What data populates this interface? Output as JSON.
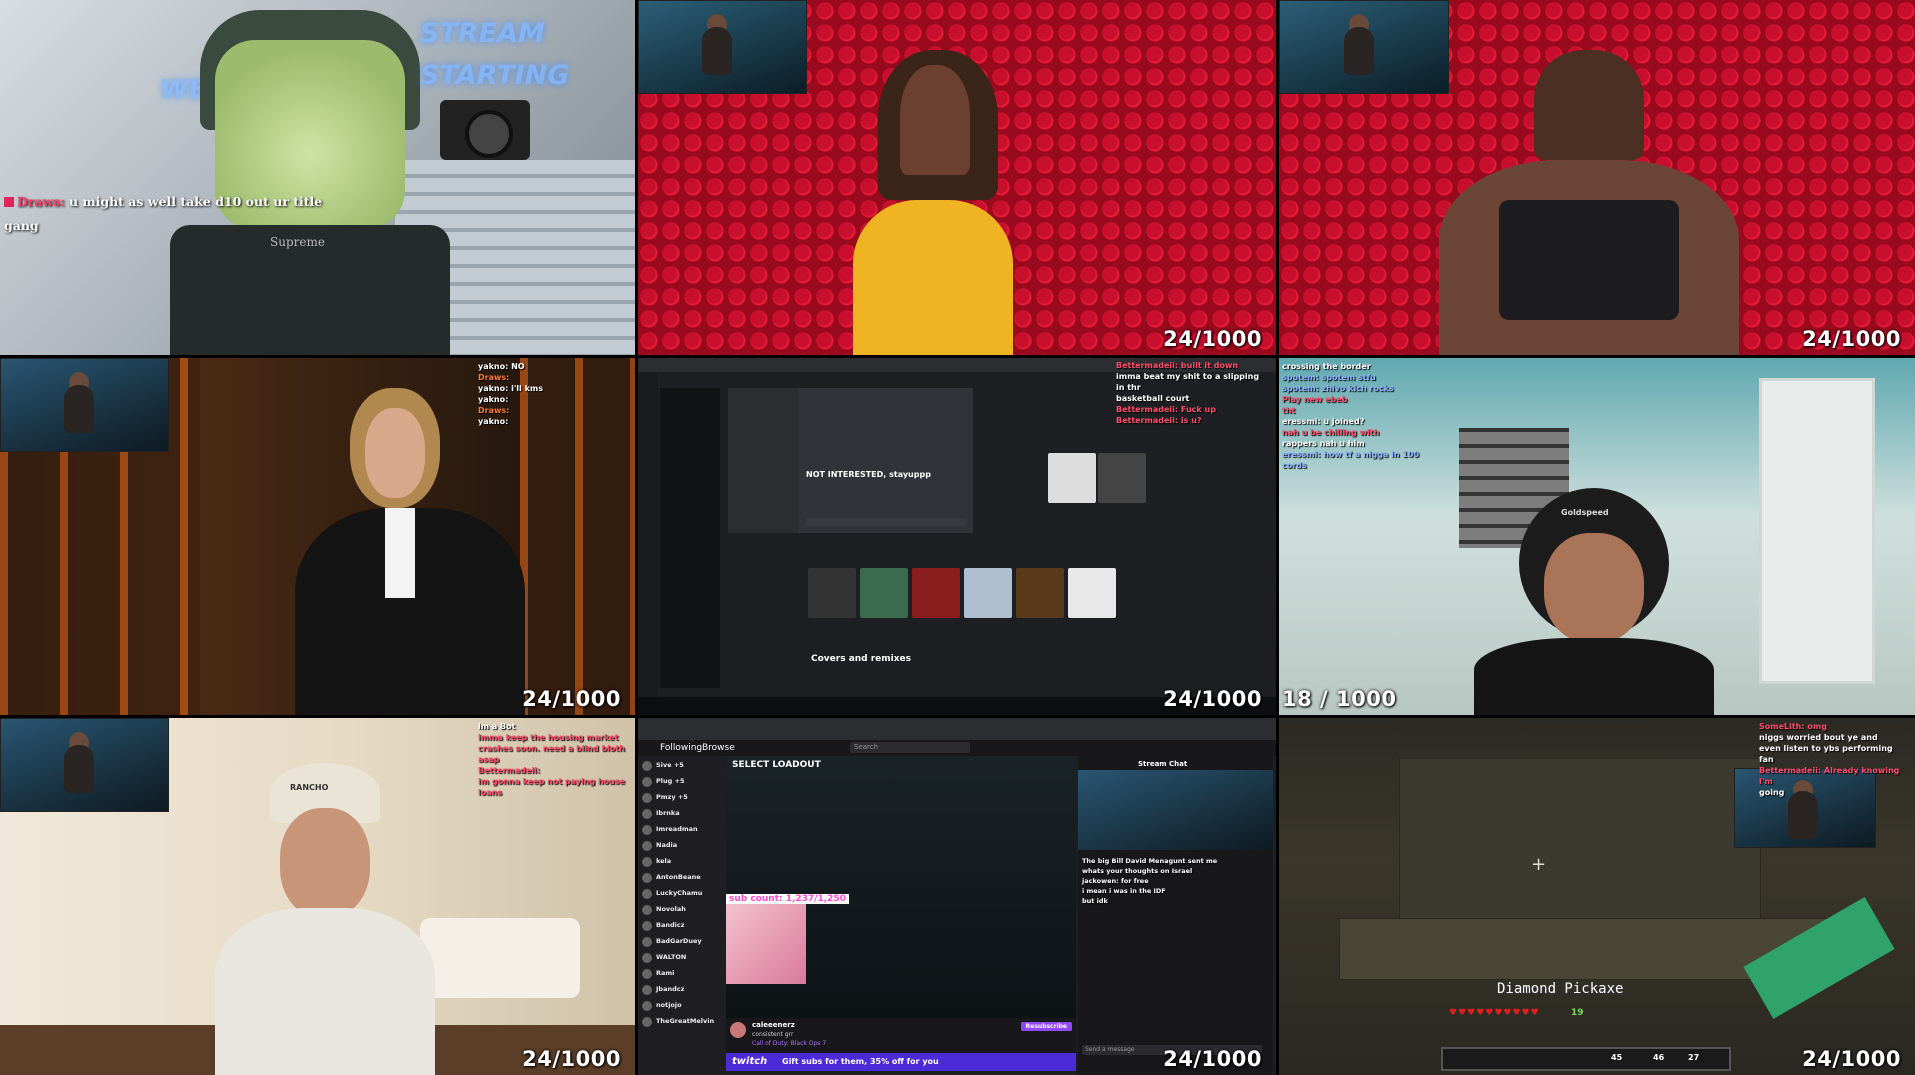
{
  "counters": {
    "t1": "",
    "t2": "24/1000",
    "t3": "24/1000",
    "t4": "24/1000",
    "t5": "24/1000",
    "t6": "18 / 1000",
    "t7": "24/1000",
    "t8": "24/1000",
    "t9": "24/1000"
  },
  "tile1": {
    "neon_top": "STREAM",
    "neon_bottom": "STARTING",
    "neon_left": "WE",
    "chat_user": "Draws:",
    "chat_message": "u might as well take d10 out ur title gang",
    "shirt_text": "Supreme"
  },
  "tile4": {
    "chat": [
      "yakno: NO",
      "Draws: ",
      "yakno: i'll kms",
      "yakno: ",
      "Draws: ",
      "yakno: "
    ]
  },
  "tile5": {
    "chat": [
      "Bettermadeii: built it down",
      "imma beat my shit to a slipping in thr",
      "basketball court",
      "Bettermadeii: Fuck up",
      "Bettermadeii: is u?"
    ],
    "window_title": "NOT INTERESTED, stayuppp",
    "section_title": "Covers and remixes"
  },
  "tile6": {
    "chat": [
      "crossing the border",
      "spotem: spotem stfu",
      "spotem: zhivo kich rocks",
      "Play new ebeb",
      "tht",
      "eressmi: u joined?",
      "nah u be chilling with",
      "rappers nah u him",
      "eressmi: how tf a nigga in 100 cords"
    ],
    "hat_text": "Goldspeed"
  },
  "tile7": {
    "chat": [
      "im a Bot",
      "imma keep the housing market",
      "crashes soon. need a blind bloth asap",
      "Bettermadeii: ",
      "im gonna keep not paying house loans"
    ],
    "cap_text": "RANCHO"
  },
  "tile8": {
    "nav": [
      "Following",
      "Browse"
    ],
    "search_placeholder": "Search",
    "loadout_title": "SELECT LOADOUT",
    "sub_count": "sub count: 1,237/1,250",
    "streamer_name": "caleeenerz",
    "streamer_status": "consistent grr",
    "game": "Call of Duty: Black Ops 7",
    "stream_chat_title": "Stream Chat",
    "send_placeholder": "Send a message",
    "sidebar_channels": [
      "Sive +5",
      "Plug +5",
      "Pmzy +5",
      "Ibrnka",
      "Imreadman",
      "Nadia",
      "kela",
      "AntonBeane",
      "LuckyChamu",
      "Novolah",
      "Bandicz",
      "BadGarDuey",
      "WALTON",
      "Rami",
      "Jbandcz",
      "notjojo",
      "TheGreatMelvin"
    ],
    "promo_brand": "twitch",
    "promo_text": "Gift subs for them, 35% off for you",
    "sub_button": "Resubscribe",
    "chat": [
      "The big Bill David Menagunt sent me",
      "whats your thoughts on Israel",
      "jackowen: for free",
      "i mean i was in the IDF",
      "but idk"
    ]
  },
  "tile9": {
    "chat": [
      "SomeLith: omg",
      "niggs worried bout ye and",
      "even listen to ybs performing fan",
      "Bettermadeii: Already knowing I'm",
      "going"
    ],
    "tooltip": "Diamond Pickaxe",
    "level": "19",
    "hotbar_counts": [
      "45",
      "46",
      "27"
    ]
  }
}
